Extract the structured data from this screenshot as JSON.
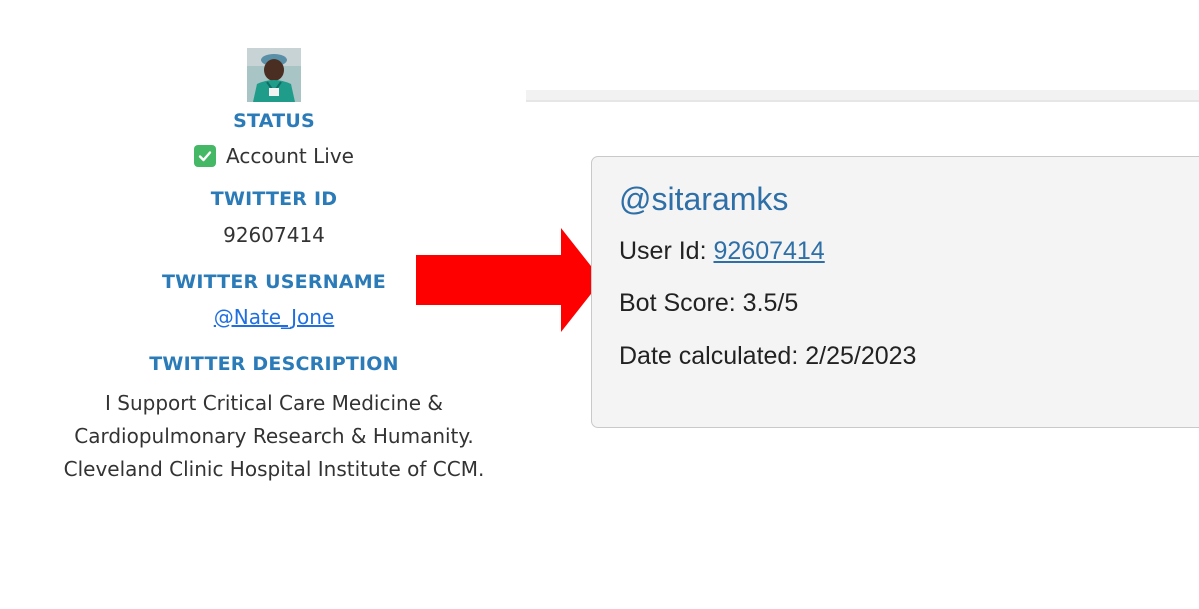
{
  "profile": {
    "avatar_alt": "profile picture",
    "status_heading": "STATUS",
    "status_icon": "check-box-icon",
    "status_value": "Account Live",
    "id_heading": "TWITTER ID",
    "id_value": "92607414",
    "username_heading": "TWITTER USERNAME",
    "username_value": "@Nate_Jone",
    "description_heading": "TWITTER DESCRIPTION",
    "description_lines": [
      "I Support Critical Care Medicine &",
      "Cardiopulmonary Research & Humanity.",
      "Cleveland Clinic Hospital Institute of CCM."
    ]
  },
  "arrow": {
    "icon": "right-arrow-icon",
    "color": "#ff0000"
  },
  "card": {
    "handle": "@sitaramks",
    "user_id_label": "User Id: ",
    "user_id_value": "92607414",
    "bot_score_label": "Bot Score: ",
    "bot_score_value": "3.5/5",
    "date_label": "Date calculated: ",
    "date_value": "2/25/2023"
  },
  "colors": {
    "heading": "#2b7bb8",
    "link": "#1f6fe0",
    "card_accent": "#2d6fa6",
    "check": "#45b865"
  }
}
